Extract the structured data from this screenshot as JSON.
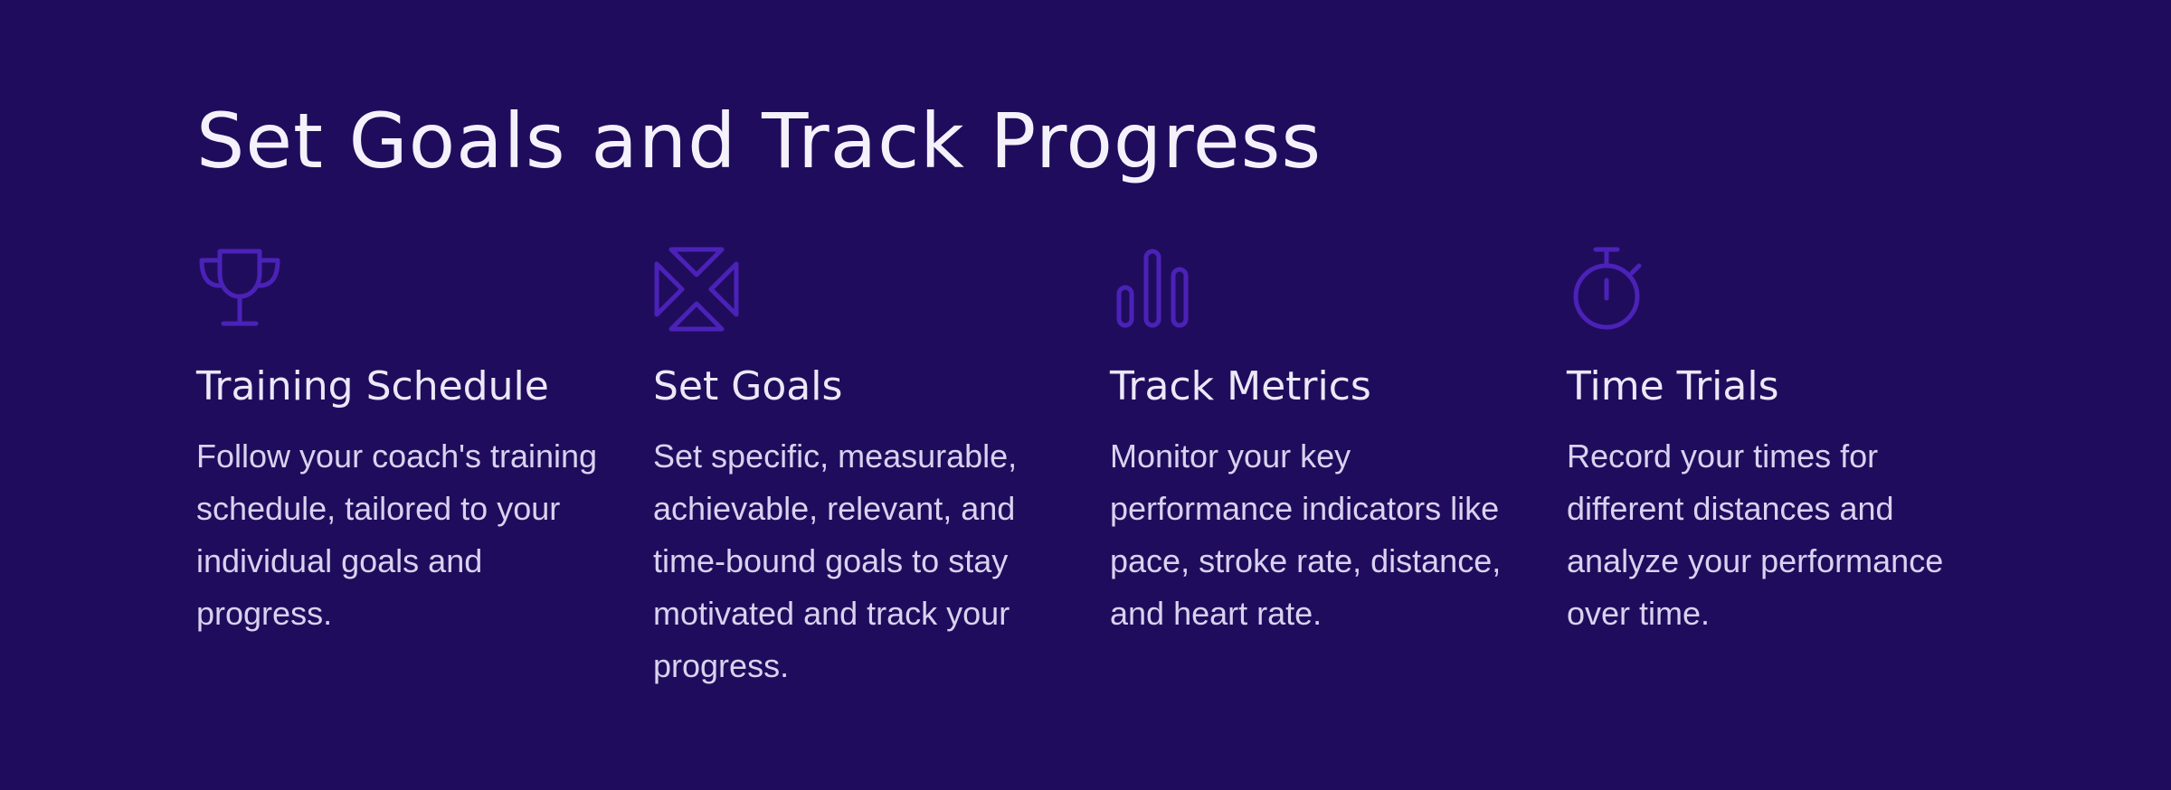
{
  "section": {
    "title": "Set Goals and Track Progress"
  },
  "colors": {
    "background": "#200c5c",
    "icon_stroke": "#4b22b8",
    "title_text": "#f4f1fb",
    "body_text": "#d9d2f0"
  },
  "features": [
    {
      "icon": "trophy-icon",
      "title": "Training Schedule",
      "description": "Follow your coach's training schedule, tailored to your individual goals and progress."
    },
    {
      "icon": "arrows-converge-icon",
      "title": "Set Goals",
      "description": "Set specific, measurable, achievable, relevant, and time-bound goals to stay motivated and track your progress."
    },
    {
      "icon": "bar-chart-icon",
      "title": "Track Metrics",
      "description": "Monitor your key performance indicators like pace, stroke rate, distance, and heart rate."
    },
    {
      "icon": "stopwatch-icon",
      "title": "Time Trials",
      "description": "Record your times for different distances and analyze your performance over time."
    }
  ]
}
